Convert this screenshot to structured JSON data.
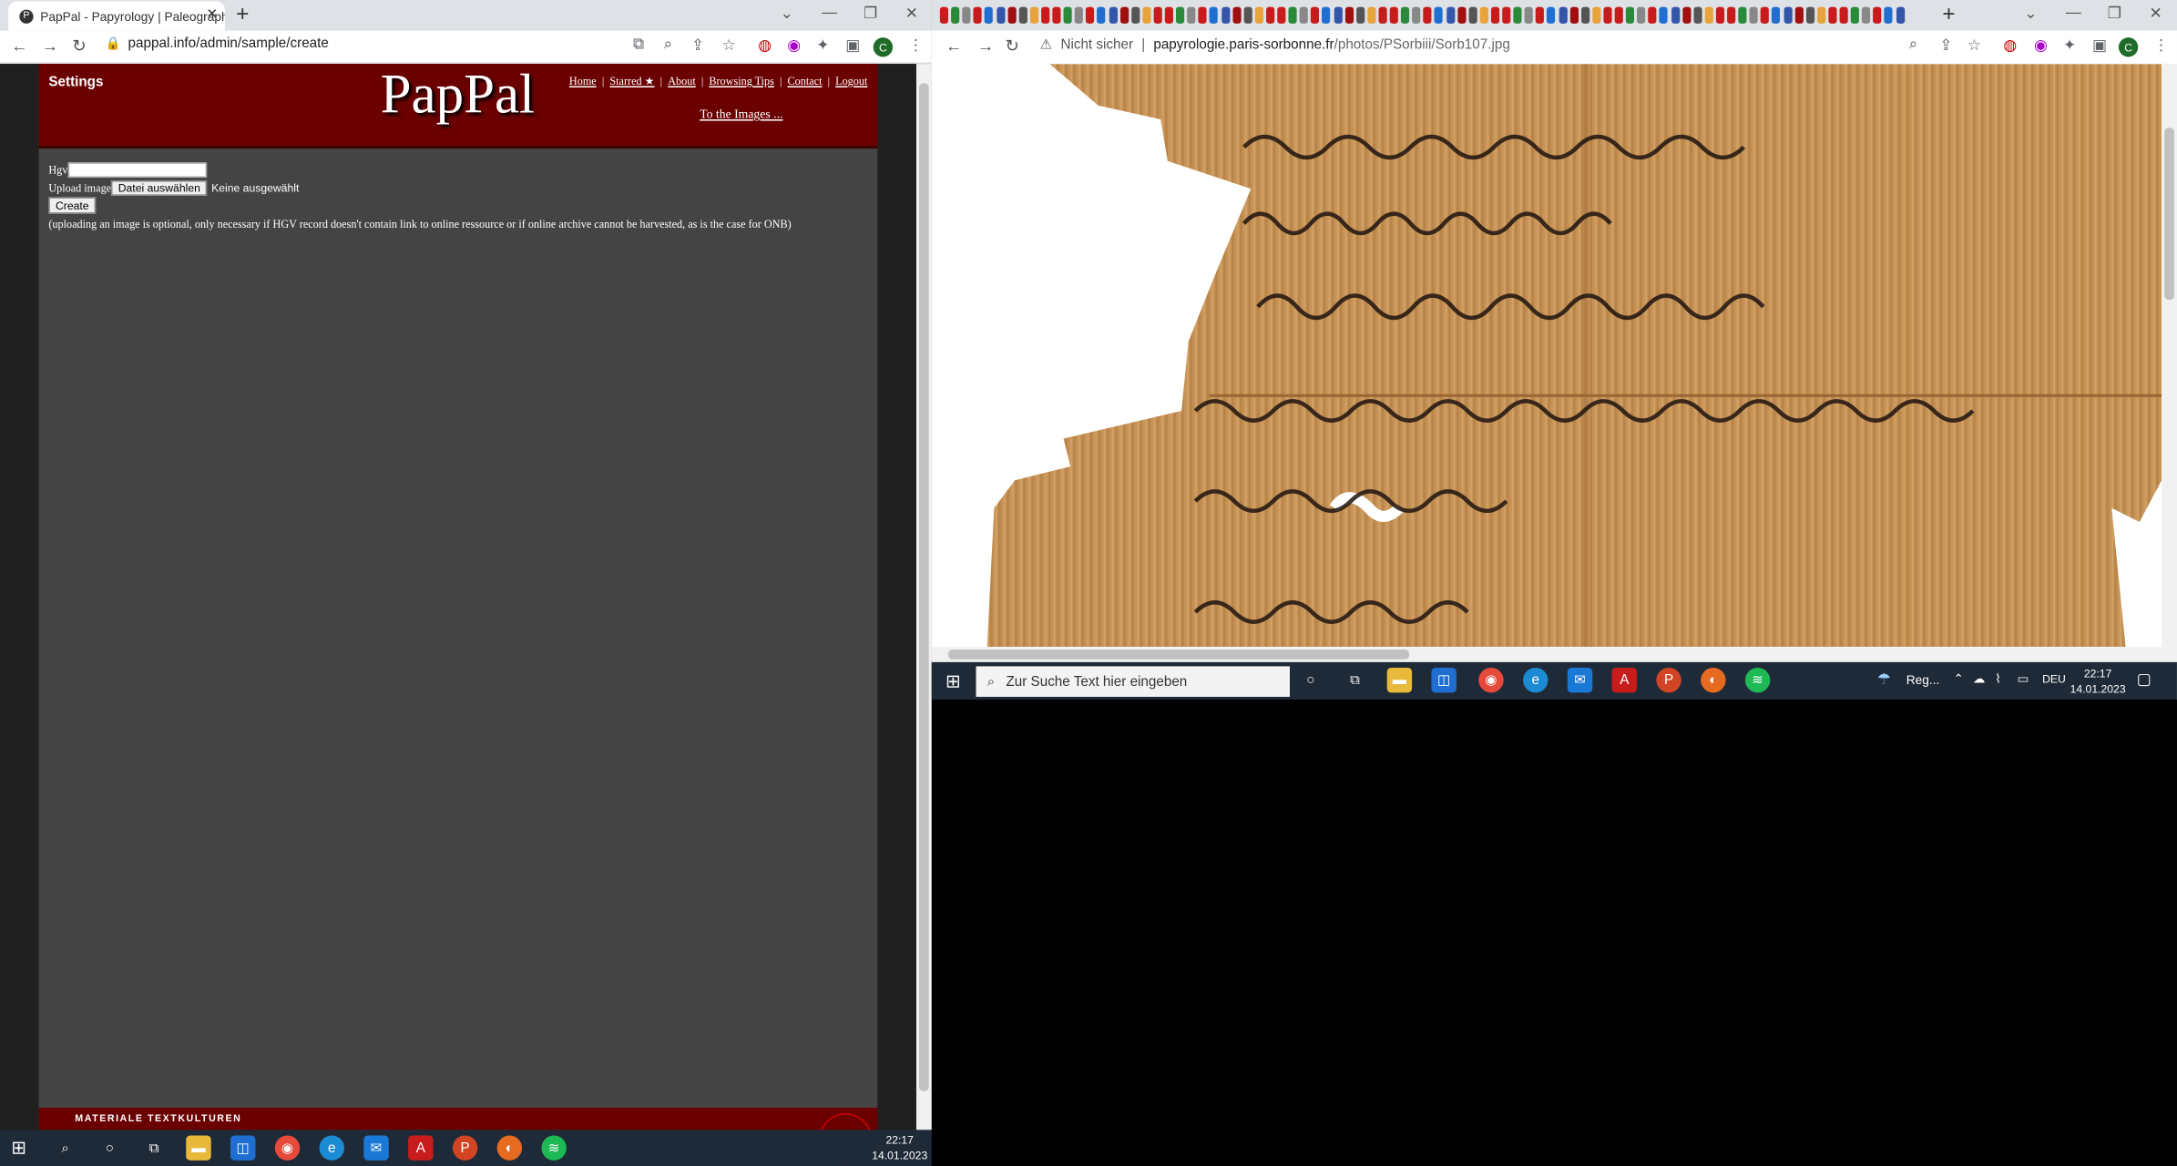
{
  "left_browser": {
    "tab_title": "PapPal - Papyrology | Paleograph",
    "url": "pappal.info/admin/sample/create",
    "site": {
      "settings": "Settings",
      "logo": "PapPal",
      "nav": [
        "Home",
        "Starred ★",
        "About",
        "Browsing Tips",
        "Contact",
        "Logout"
      ],
      "to_images": "To the Images ...",
      "form": {
        "hgv_label": "Hgv",
        "upload_label": "Upload image",
        "file_button": "Datei auswählen",
        "file_status": "Keine ausgewählt",
        "create_button": "Create",
        "note": "(uploading an image is optional, only necessary if HGV record doesn't contain link to online ressource or if online archive cannot be harvested, as is the case for ONB)"
      },
      "footer_text": "MATERIALE TEXTKULTUREN"
    }
  },
  "right_browser": {
    "security": "Nicht sicher",
    "url_domain": "papyrologie.paris-sorbonne.fr",
    "url_path": "/photos/PSorbiii/Sorb107.jpg"
  },
  "right_taskbar": {
    "search_placeholder": "Zur Suche Text hier eingeben",
    "weather": "Reg...",
    "lang": "DEU",
    "time": "22:17",
    "date": "14.01.2023"
  },
  "left_taskbar": {
    "time": "22:17",
    "date": "14.01.2023"
  },
  "colors": {
    "header": "#6b0000",
    "site_bg": "#444444",
    "taskbar": "#1f2a38"
  }
}
